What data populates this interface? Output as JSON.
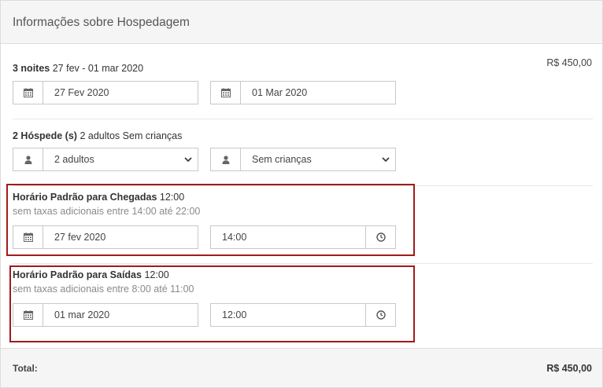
{
  "header": {
    "title": "Informações sobre Hospedagem"
  },
  "stay": {
    "nights_bold": "3 noites",
    "dates_text": "27 fev - 01 mar 2020",
    "price": "R$ 450,00",
    "checkin_date": "27 Fev 2020",
    "checkout_date": "01 Mar 2020"
  },
  "guests": {
    "count_bold": "2 Hóspede (s)",
    "summary": "2 adultos Sem crianças",
    "adults_selected": "2 adultos",
    "children_selected": "Sem crianças"
  },
  "arrival": {
    "title_bold": "Horário Padrão para Chegadas",
    "time_text": "12:00",
    "note": "sem taxas adicionais entre 14:00 até 22:00",
    "date": "27 fev 2020",
    "time": "14:00"
  },
  "departure": {
    "title_bold": "Horário Padrão para Saídas",
    "time_text": "12:00",
    "note": "sem taxas adicionais entre 8:00 até 11:00",
    "date": "01 mar 2020",
    "time": "12:00"
  },
  "footer": {
    "total_label": "Total:",
    "total_value": "R$ 450,00"
  },
  "icons": {
    "calendar": "calendar-icon",
    "user": "user-icon",
    "clock": "clock-icon",
    "chevron": "chevron-down-icon"
  },
  "colors": {
    "highlight_border": "#a11b1b",
    "header_bg": "#f5f5f5"
  }
}
